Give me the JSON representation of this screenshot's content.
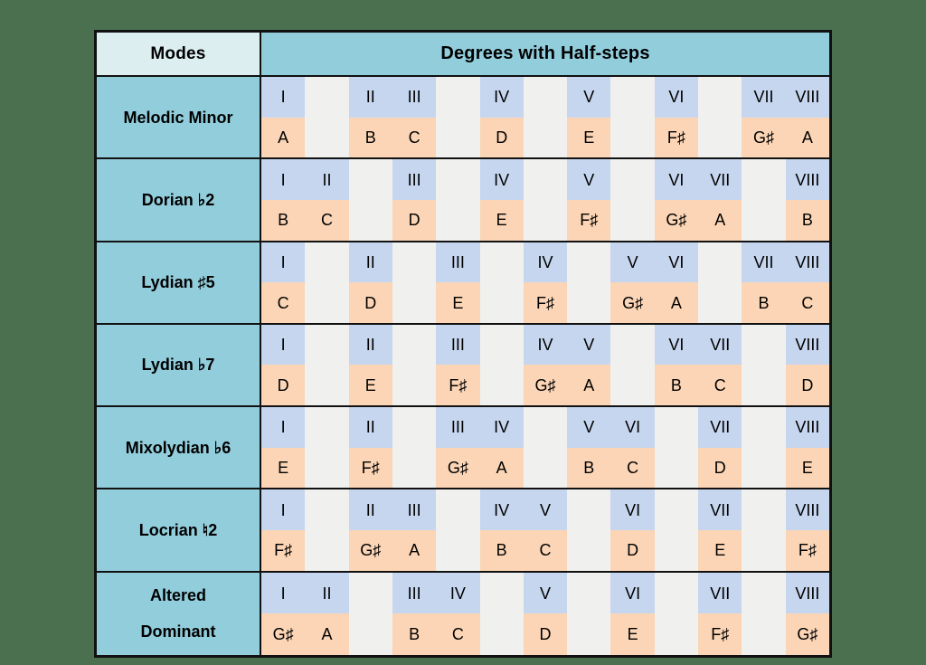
{
  "header": {
    "modes_label": "Modes",
    "degrees_label": "Degrees with Half-steps"
  },
  "colors": {
    "background": "#4a7050",
    "header_teal": "#92cddc",
    "modes_head": "#ddeef1",
    "roman_blue": "#c6d6ef",
    "note_orange": "#fbd5b5",
    "gap_gray": "#f0f0ef",
    "border": "#111111"
  },
  "chromatic_slots": 13,
  "rows": [
    {
      "mode": "Melodic Minor",
      "mode_line2": "",
      "slots": [
        {
          "pos": 0,
          "degree": "I",
          "note": "A"
        },
        {
          "pos": 2,
          "degree": "II",
          "note": "B"
        },
        {
          "pos": 3,
          "degree": "III",
          "note": "C"
        },
        {
          "pos": 5,
          "degree": "IV",
          "note": "D"
        },
        {
          "pos": 7,
          "degree": "V",
          "note": "E"
        },
        {
          "pos": 9,
          "degree": "VI",
          "note": "F♯"
        },
        {
          "pos": 11,
          "degree": "VII",
          "note": "G♯"
        },
        {
          "pos": 12,
          "degree": "VIII",
          "note": "A"
        }
      ]
    },
    {
      "mode": "Dorian ♭2",
      "mode_line2": "",
      "slots": [
        {
          "pos": 0,
          "degree": "I",
          "note": "B"
        },
        {
          "pos": 1,
          "degree": "II",
          "note": "C"
        },
        {
          "pos": 3,
          "degree": "III",
          "note": "D"
        },
        {
          "pos": 5,
          "degree": "IV",
          "note": "E"
        },
        {
          "pos": 7,
          "degree": "V",
          "note": "F♯"
        },
        {
          "pos": 9,
          "degree": "VI",
          "note": "G♯"
        },
        {
          "pos": 10,
          "degree": "VII",
          "note": "A"
        },
        {
          "pos": 12,
          "degree": "VIII",
          "note": "B"
        }
      ]
    },
    {
      "mode": "Lydian ♯5",
      "mode_line2": "",
      "slots": [
        {
          "pos": 0,
          "degree": "I",
          "note": "C"
        },
        {
          "pos": 2,
          "degree": "II",
          "note": "D"
        },
        {
          "pos": 4,
          "degree": "III",
          "note": "E"
        },
        {
          "pos": 6,
          "degree": "IV",
          "note": "F♯"
        },
        {
          "pos": 8,
          "degree": "V",
          "note": "G♯"
        },
        {
          "pos": 9,
          "degree": "VI",
          "note": "A"
        },
        {
          "pos": 11,
          "degree": "VII",
          "note": "B"
        },
        {
          "pos": 12,
          "degree": "VIII",
          "note": "C"
        }
      ]
    },
    {
      "mode": "Lydian ♭7",
      "mode_line2": "",
      "slots": [
        {
          "pos": 0,
          "degree": "I",
          "note": "D"
        },
        {
          "pos": 2,
          "degree": "II",
          "note": "E"
        },
        {
          "pos": 4,
          "degree": "III",
          "note": "F♯"
        },
        {
          "pos": 6,
          "degree": "IV",
          "note": "G♯"
        },
        {
          "pos": 7,
          "degree": "V",
          "note": "A"
        },
        {
          "pos": 9,
          "degree": "VI",
          "note": "B"
        },
        {
          "pos": 10,
          "degree": "VII",
          "note": "C"
        },
        {
          "pos": 12,
          "degree": "VIII",
          "note": "D"
        }
      ]
    },
    {
      "mode": "Mixolydian ♭6",
      "mode_line2": "",
      "slots": [
        {
          "pos": 0,
          "degree": "I",
          "note": "E"
        },
        {
          "pos": 2,
          "degree": "II",
          "note": "F♯"
        },
        {
          "pos": 4,
          "degree": "III",
          "note": "G♯"
        },
        {
          "pos": 5,
          "degree": "IV",
          "note": "A"
        },
        {
          "pos": 7,
          "degree": "V",
          "note": "B"
        },
        {
          "pos": 8,
          "degree": "VI",
          "note": "C"
        },
        {
          "pos": 10,
          "degree": "VII",
          "note": "D"
        },
        {
          "pos": 12,
          "degree": "VIII",
          "note": "E"
        }
      ]
    },
    {
      "mode": "Locrian ♮2",
      "mode_line2": "",
      "slots": [
        {
          "pos": 0,
          "degree": "I",
          "note": "F♯"
        },
        {
          "pos": 2,
          "degree": "II",
          "note": "G♯"
        },
        {
          "pos": 3,
          "degree": "III",
          "note": "A"
        },
        {
          "pos": 5,
          "degree": "IV",
          "note": "B"
        },
        {
          "pos": 6,
          "degree": "V",
          "note": "C"
        },
        {
          "pos": 8,
          "degree": "VI",
          "note": "D"
        },
        {
          "pos": 10,
          "degree": "VII",
          "note": "E"
        },
        {
          "pos": 12,
          "degree": "VIII",
          "note": "F♯"
        }
      ]
    },
    {
      "mode": "Altered",
      "mode_line2": "Dominant",
      "slots": [
        {
          "pos": 0,
          "degree": "I",
          "note": "G♯"
        },
        {
          "pos": 1,
          "degree": "II",
          "note": "A"
        },
        {
          "pos": 3,
          "degree": "III",
          "note": "B"
        },
        {
          "pos": 4,
          "degree": "IV",
          "note": "C"
        },
        {
          "pos": 6,
          "degree": "V",
          "note": "D"
        },
        {
          "pos": 8,
          "degree": "VI",
          "note": "E"
        },
        {
          "pos": 10,
          "degree": "VII",
          "note": "F♯"
        },
        {
          "pos": 12,
          "degree": "VIII",
          "note": "G♯"
        }
      ]
    }
  ]
}
